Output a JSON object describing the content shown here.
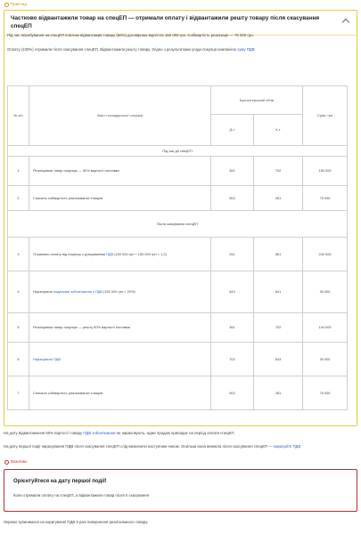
{
  "example_label": "Приклад",
  "example_title": "Частково відвантажили товар на спецЕП — отримали оплату і відвантажили решту товару після скасування спецЕП",
  "intro_1": "Під час перебування на спецЕП платник відвантажив товару (50%) договірною вартістю 150 000 грн. Собівартість реалізації — 75 000 грн.",
  "intro_2_text": "Оплату (100%) отримали після скасування спецЕП. Відвантажили решту товару. Згідно з результатами угоди покупця компанією ",
  "intro_2_link": "суму ПДВ",
  "table": {
    "headers": {
      "num": "№ з/п",
      "op": "Зміст господарської операції",
      "acc": "Бухгалтерський облік",
      "dt": "Д-т",
      "kt": "К-т",
      "sum": "Сума, грн"
    },
    "section_1": "Під час дії спецЕП",
    "section_2": "Після скасування спецЕП",
    "rows_1": [
      {
        "num": "1",
        "op": "Реалізували товар покупцю — 50% вартості поставки",
        "dt": "361",
        "kt": "702",
        "sum": "150 000"
      },
      {
        "num": "2",
        "op": "Списали собівартість реалізованих товарів",
        "dt": "902",
        "kt": "281",
        "sum": "75 000"
      }
    ],
    "row_3": {
      "num": "3",
      "op_a": "Отримали оплату від покупця з урахуванням ",
      "op_link": "ПДВ",
      "op_b": " (150 000 грн + 150 000 грн × 1,2)",
      "dt": "311",
      "kt": "361",
      "sum": "240 000"
    },
    "row_4": {
      "num": "4",
      "op_a": "Нарахували ",
      "op_link": "податкове зобов'язання з ПДВ",
      "op_b": " (150 000 грн × 20%)",
      "dt": "643",
      "kt": "641",
      "sum": "30 000"
    },
    "row_5": {
      "num": "5",
      "op": "Реалізували товар покупцю — решту 50% вартості поставки",
      "dt": "361",
      "kt": "702",
      "sum": "144 000"
    },
    "row_6": {
      "num": "6",
      "op_link": "Нарахували ПДВ",
      "dt": "702",
      "kt": "643",
      "sum": "30 000"
    },
    "row_7": {
      "num": "7",
      "op": "Списали собівартість реалізованих товарів",
      "dt": "902",
      "kt": "281",
      "sum": "75 000"
    }
  },
  "after_1_a": "На дату відвантаження 50% вартості товару ",
  "after_1_link": "ПДВ зобов'язання",
  "after_1_b": " не нараховують, адже продаж припадає на період оплати спецЕП.",
  "after_2_a": "На дату першої події нарахування ПДВ після скасування спецЕП слід визначити наступним чином. Оскільки вона виникла після скасування спецЕП — ",
  "after_2_link": "нарахуйте ПДВ",
  "important_label": "Важливо",
  "important_title": "Орієнтуйтеся на дату першої події!",
  "important_text": "Коли отримали оплату на спецЕП, а відвантажили товар після її скасування",
  "footer": "Окремо зупинимося на коригуванні ПДВ в разі повернення реалізованого товару."
}
